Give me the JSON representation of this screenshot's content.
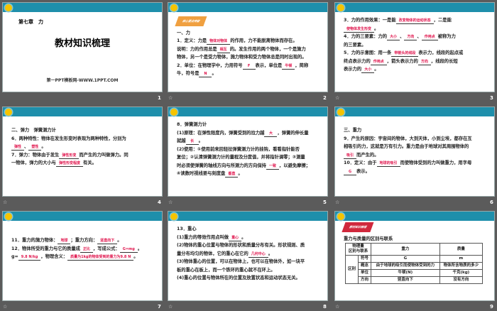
{
  "slides": [
    {
      "number": "1",
      "chapter": "第七章　力",
      "title": "教材知识梳理",
      "site": "第一PPT模板网-WWW.1PPT.COM"
    },
    {
      "number": "2",
      "tag": "核心要点突破",
      "lines": [
        [
          {
            "t": "一、力"
          }
        ],
        [
          {
            "t": "1．定义：力是"
          },
          {
            "b": "物体对物体"
          },
          {
            "t": "的作用，力不能脱离物体而存在。"
          }
        ],
        [
          {
            "t": "说明：力的作用总是"
          },
          {
            "b": "相互"
          },
          {
            "t": "的。发生作用的两个物体，一个是施力"
          }
        ],
        [
          {
            "t": "物体，另一个是受力物体，施力物体和受力物体总是同时出现的。"
          }
        ],
        [
          {
            "t": "2．单位：在物理学中，力用符号"
          },
          {
            "b": "F"
          },
          {
            "t": "表示，单位是"
          },
          {
            "b": "牛顿"
          },
          {
            "t": "，简称"
          }
        ],
        [
          {
            "t": "牛，符号是"
          },
          {
            "b": "N"
          },
          {
            "t": "。"
          }
        ]
      ]
    },
    {
      "number": "3",
      "lines": [
        [
          {
            "t": "3．力的作用效果：一是能"
          },
          {
            "b": "改变物体的运动状态"
          },
          {
            "t": "，二是能"
          }
        ],
        [
          {
            "b": "使物体发生形变"
          },
          {
            "t": "。"
          }
        ],
        [
          {
            "t": "4．力的三要素：力的"
          },
          {
            "b": "大小"
          },
          {
            "t": "、"
          },
          {
            "b": "方向"
          },
          {
            "t": "、"
          },
          {
            "b": "作用点"
          },
          {
            "t": "被称为力"
          }
        ],
        [
          {
            "t": "的三要素。"
          }
        ],
        [
          {
            "t": "5．力的示意图：用一条"
          },
          {
            "b": "带箭头的线段"
          },
          {
            "t": "表示力，线段的起点或"
          }
        ],
        [
          {
            "t": "终点表示力的"
          },
          {
            "b": "作用点"
          },
          {
            "t": "，箭头表示力的"
          },
          {
            "b": "方向"
          },
          {
            "t": "，线段的长短"
          }
        ],
        [
          {
            "t": "表示力的"
          },
          {
            "b": "大小"
          },
          {
            "t": "。"
          }
        ]
      ]
    },
    {
      "number": "4",
      "lines": [
        [
          {
            "t": "二、弹力　弹簧测力计"
          }
        ],
        [
          {
            "t": "6．两种特性：物体在发生形变时表现为两种特性，分别为"
          }
        ],
        [
          {
            "b": "弹性"
          },
          {
            "t": "、"
          },
          {
            "b": "塑性"
          },
          {
            "t": "。"
          }
        ],
        [
          {
            "t": "7．弹力：物体由于发生"
          },
          {
            "b": "弹性形变"
          },
          {
            "t": "而产生的力叫做弹力。同"
          }
        ],
        [
          {
            "t": "一物体，弹力的大小与"
          },
          {
            "b": "弹性形变程度"
          },
          {
            "t": "有关。"
          }
        ]
      ]
    },
    {
      "number": "5",
      "lines": [
        [
          {
            "t": "8．弹簧测力计"
          }
        ],
        [
          {
            "t": "(1)原理：在弹性限度内，弹簧受到的拉力越"
          },
          {
            "b": "大"
          },
          {
            "t": "，弹簧的伸长量"
          }
        ],
        [
          {
            "t": "就越"
          },
          {
            "b": "长"
          },
          {
            "t": "。"
          }
        ],
        [
          {
            "t": "(2)使用：①使用前来回轻拉弹簧测力计的挂钩，看看指针能否"
          }
        ],
        [
          {
            "t": "复位；②认清弹簧测力计的量程及分度值，并将指针调零；③测量"
          }
        ],
        [
          {
            "t": "时必须使弹簧的轴线方向与所测力的方向保持"
          },
          {
            "b": "一致"
          },
          {
            "t": "，以避免摩擦；"
          }
        ],
        [
          {
            "t": "④读数时视线要与刻度盘"
          },
          {
            "b": "垂直"
          },
          {
            "t": "。"
          }
        ]
      ]
    },
    {
      "number": "6",
      "lines": [
        [
          {
            "t": "三、重力"
          }
        ],
        [
          {
            "t": "9．产生的原因：宇宙间的物体，大到天体，小到尘埃，都存在互"
          }
        ],
        [
          {
            "t": "相吸引的力，这就是万有引力。重力是由于地球对其周围物体的"
          }
        ],
        [
          {
            "b": "吸引"
          },
          {
            "t": "而产生的。"
          }
        ],
        [
          {
            "t": "10．定义：由于"
          },
          {
            "b": "地球的吸引"
          },
          {
            "t": "而使物体受到的力叫做重力，用字母"
          }
        ],
        [
          {
            "b": "G"
          },
          {
            "t": "表示。"
          }
        ]
      ]
    },
    {
      "number": "7",
      "lines": [
        [
          {
            "t": "11．重力的施力物体："
          },
          {
            "b": "地球"
          },
          {
            "t": "；重力方向："
          },
          {
            "b": "竖直向下"
          },
          {
            "t": "。"
          }
        ],
        [
          {
            "t": "12．物体所受的重力与它的质量成"
          },
          {
            "b": "正比"
          },
          {
            "t": "，写成公式："
          },
          {
            "b": "G=mg"
          },
          {
            "t": "。"
          }
        ],
        [
          {
            "t": "g="
          },
          {
            "b": "9.8 N/kg"
          },
          {
            "t": "，物理含义："
          },
          {
            "b": "质量为1kg的物体受到的重力为9.8 N"
          },
          {
            "t": "。"
          }
        ]
      ]
    },
    {
      "number": "8",
      "lines": [
        [
          {
            "t": "13．重心"
          }
        ],
        [
          {
            "t": "(1)重力的等效作用点叫做"
          },
          {
            "b": "重心"
          },
          {
            "t": "。"
          }
        ],
        [
          {
            "t": "(2)物体的重心位置与物体的形状和质量分布有关。形状规则、质"
          }
        ],
        [
          {
            "t": "量分布均匀的物体，它的重心在它的"
          },
          {
            "b": "几何中心"
          },
          {
            "t": "。"
          }
        ],
        [
          {
            "t": "(3)物体重心的位置，可以在物体上，也可以在物体外，如一块平"
          }
        ],
        [
          {
            "t": "板的重心在板上，而一个铁环的重心就不在环上。"
          }
        ],
        [
          {
            "t": "(4)重心的位置与物体所在的位置及放置状态和运动状态无关。"
          }
        ]
      ]
    },
    {
      "number": "9",
      "tag": "教材知识梳理",
      "heading": "重力与质量的区别与联系",
      "table": {
        "corner": "物理量\n区别与联系",
        "col1": "重力",
        "col2": "质量",
        "group": "区别",
        "rows": [
          [
            "符号",
            "G",
            "m"
          ],
          [
            "概念",
            "由于地球的吸引而使物体受到的力",
            "物体所含物质的多少"
          ],
          [
            "单位",
            "牛顿(N)",
            "千克(kg)"
          ],
          [
            "方向",
            "竖直向下",
            "没有方向"
          ]
        ]
      }
    }
  ],
  "star_icon": "☆"
}
